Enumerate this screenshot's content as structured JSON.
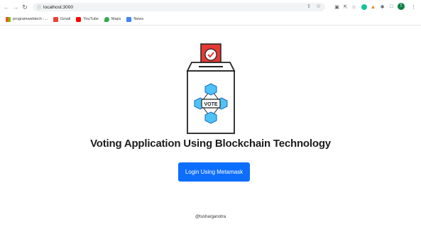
{
  "browser": {
    "url": "localhost:3000",
    "bookmarks": [
      {
        "label": "programwebtech -...",
        "icon": "windows-icon"
      },
      {
        "label": "Gmail",
        "icon": "gmail-icon"
      },
      {
        "label": "YouTube",
        "icon": "youtube-icon"
      },
      {
        "label": "Maps",
        "icon": "maps-icon"
      },
      {
        "label": "News",
        "icon": "news-icon"
      }
    ],
    "profile_initial": "T"
  },
  "main": {
    "logo_text": "VOTE",
    "title": "Voting Application Using Blockchain Technology",
    "login_label": "Login Using Metamask",
    "footer": "@tusharganotra"
  },
  "colors": {
    "accent": "#0d6efd",
    "ballot_red": "#e53935",
    "chain_blue": "#4fc3f7"
  }
}
